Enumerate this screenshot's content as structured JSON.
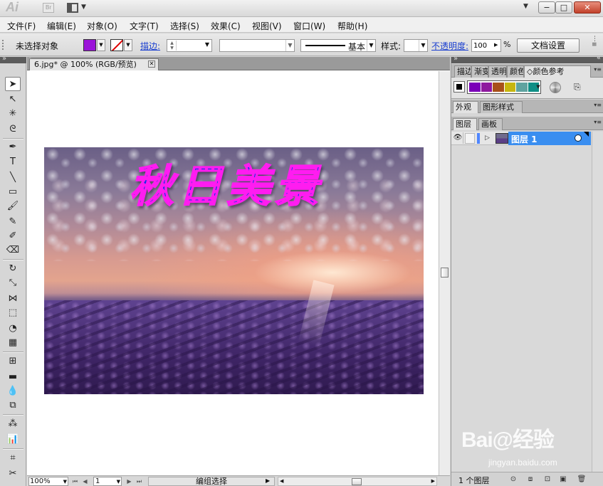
{
  "app": {
    "logo": "Ai",
    "bridge_badge": "Br"
  },
  "menu": [
    {
      "id": "file",
      "label": "文件(F)"
    },
    {
      "id": "edit",
      "label": "编辑(E)"
    },
    {
      "id": "object",
      "label": "对象(O)"
    },
    {
      "id": "type",
      "label": "文字(T)"
    },
    {
      "id": "select",
      "label": "选择(S)"
    },
    {
      "id": "effect",
      "label": "效果(C)"
    },
    {
      "id": "view",
      "label": "视图(V)"
    },
    {
      "id": "window",
      "label": "窗口(W)"
    },
    {
      "id": "help",
      "label": "帮助(H)"
    }
  ],
  "control_bar": {
    "selection_status": "未选择对象",
    "fill_color": "#9b14d9",
    "stroke_label": "描边:",
    "brush_label": "基本",
    "style_label": "样式:",
    "opacity_label": "不透明度:",
    "opacity_value": "100",
    "opacity_unit": "%",
    "doc_setup_label": "文档设置"
  },
  "document": {
    "tab_title": "6.jpg* @ 100% (RGB/预览)",
    "artwork_title": "秋日美景",
    "artwork_text_fill": "#ff1ff0",
    "artwork_dot_color": "#1a2ee6"
  },
  "status_bar": {
    "zoom": "100%",
    "page": "1",
    "status_text": "编组选择"
  },
  "panels": {
    "top_tabs": [
      {
        "id": "stroke",
        "label": "描边"
      },
      {
        "id": "gradient",
        "label": "渐变"
      },
      {
        "id": "transparency",
        "label": "透明"
      },
      {
        "id": "color",
        "label": "颜色"
      },
      {
        "id": "color-guide",
        "label": "◇颜色参考"
      }
    ],
    "color_guide_swatches": [
      "#7a00b8",
      "#8e1a9e",
      "#a8501a",
      "#c7b60f",
      "#5fa3a0",
      "#108f86"
    ],
    "middle_tabs": [
      {
        "id": "appearance",
        "label": "外观"
      },
      {
        "id": "graphic-styles",
        "label": "图形样式"
      }
    ],
    "layer_tabs": [
      {
        "id": "layers",
        "label": "图层"
      },
      {
        "id": "artboards",
        "label": "画板"
      }
    ],
    "layers": [
      {
        "name": "图层 1",
        "color": "#4f86ff"
      }
    ],
    "layers_count": "1 个图层"
  },
  "watermark": {
    "text": "Bai@经验",
    "url": "jingyan.baidu.com"
  }
}
